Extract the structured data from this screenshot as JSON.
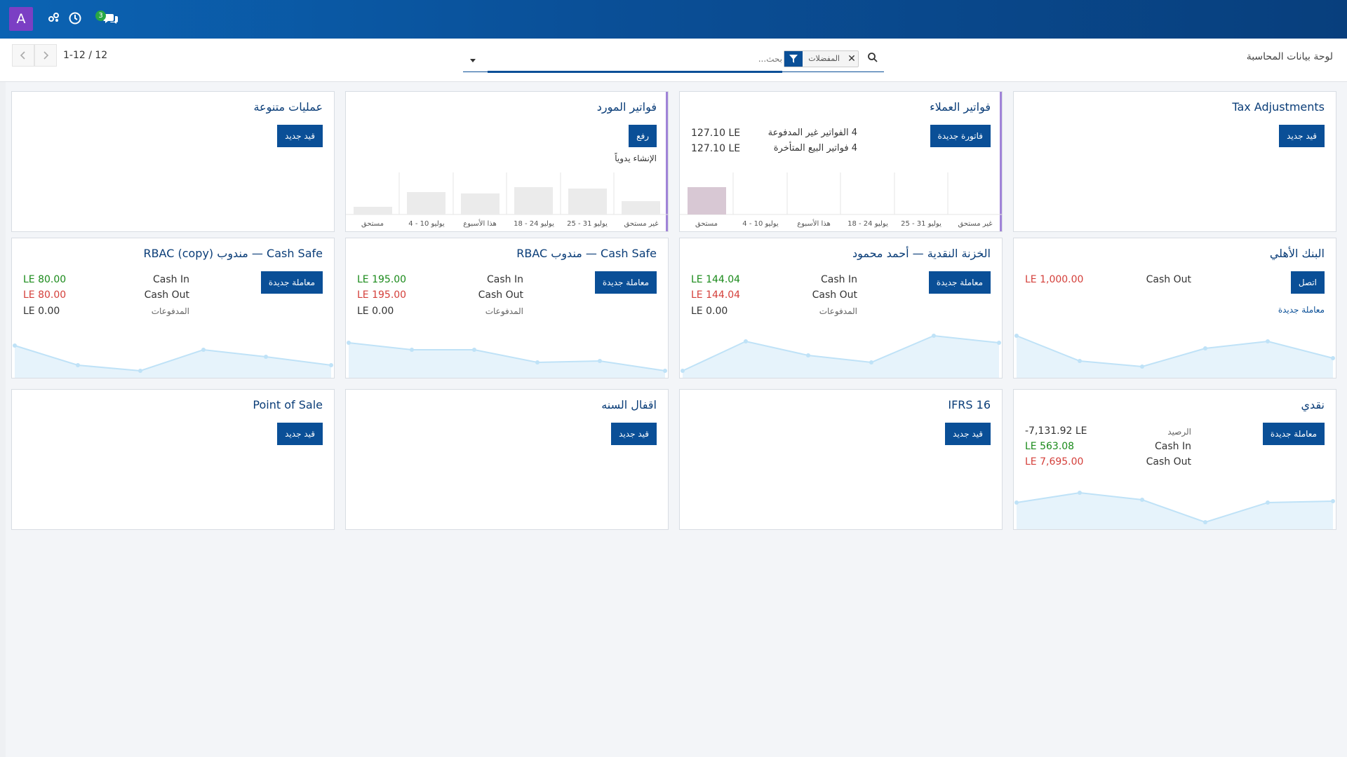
{
  "navbar": {
    "avatar_letter": "A",
    "chat_count": "3"
  },
  "control": {
    "breadcrumb": "لوحة بيانات المحاسبة",
    "facet_label": "المفضلات",
    "search_placeholder": "بحث...",
    "pager": "1-12 / 12"
  },
  "cards": {
    "tax": {
      "title": "Tax Adjustments",
      "button": "قيد جديد"
    },
    "customer": {
      "title": "فواتير العملاء",
      "button": "فاتورة جديدة",
      "stat1_label": "4 الفواتير غير المدفوعة",
      "stat1_value": "127.10 LE",
      "stat2_label": "4 فواتير البيع المتأخرة",
      "stat2_value": "127.10 LE",
      "axis": [
        "مستحق",
        "4 - 10 يوليو",
        "هذا الأسبوع",
        "18 - 24 يوليو",
        "25 - 31 يوليو",
        "غير مستحق"
      ]
    },
    "vendor": {
      "title": "فواتير المورد",
      "button": "رفع",
      "link": "الإنشاء يدوياً",
      "axis": [
        "مستحق",
        "4 - 10 يوليو",
        "هذا الأسبوع",
        "18 - 24 يوليو",
        "25 - 31 يوليو",
        "غير مستحق"
      ]
    },
    "misc": {
      "title": "عمليات متنوعة",
      "button": "قيد جديد"
    },
    "ahly": {
      "title": "البنك الأهلي",
      "button": "اتصل",
      "link": "معاملة جديدة",
      "cash_out_label": "Cash Out",
      "cash_out_value": "LE 1,000.00"
    },
    "treasury": {
      "title": "الخزنة النقدية — أحمد محمود",
      "button": "معاملة جديدة",
      "cash_in_label": "Cash In",
      "cash_in_value": "LE 144.04",
      "cash_out_label": "Cash Out",
      "cash_out_value": "LE 144.04",
      "payments_label": "المدفوعات",
      "payments_value": "LE 0.00"
    },
    "rbac": {
      "title": "Cash Safe — مندوب RBAC",
      "button": "معاملة جديدة",
      "cash_in_label": "Cash In",
      "cash_in_value": "LE 195.00",
      "cash_out_label": "Cash Out",
      "cash_out_value": "LE 195.00",
      "payments_label": "المدفوعات",
      "payments_value": "LE 0.00"
    },
    "rbac_copy": {
      "title": "Cash Safe — مندوب RBAC (copy)",
      "button": "معاملة جديدة",
      "cash_in_label": "Cash In",
      "cash_in_value": "LE 80.00",
      "cash_out_label": "Cash Out",
      "cash_out_value": "LE 80.00",
      "payments_label": "المدفوعات",
      "payments_value": "LE 0.00"
    },
    "cash": {
      "title": "نقدي",
      "button": "معاملة جديدة",
      "balance_label": "الرصيد",
      "balance_value": "-7,131.92 LE",
      "cash_in_label": "Cash In",
      "cash_in_value": "LE 563.08",
      "cash_out_label": "Cash Out",
      "cash_out_value": "LE 7,695.00"
    },
    "ifrs": {
      "title": "IFRS 16",
      "button": "قيد جديد"
    },
    "year_close": {
      "title": "اقفال السنه",
      "button": "قيد جديد"
    },
    "pos": {
      "title": "Point of Sale",
      "button": "قيد جديد"
    }
  },
  "colors": {
    "navbar": "#0a4f97",
    "button": "#0a4f97",
    "positive": "#1a8a1a",
    "negative": "#d43f3a",
    "accent": "#a083d8"
  }
}
